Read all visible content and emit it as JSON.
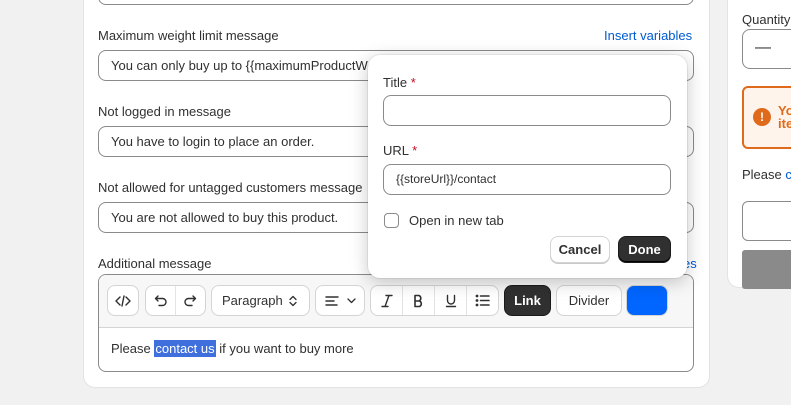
{
  "form": {
    "max_weight": {
      "label": "Maximum weight limit message",
      "insert_variables": "Insert variables",
      "value": "You can only buy up to {{maximumProductWeight}}"
    },
    "not_logged_in": {
      "label": "Not logged in message",
      "value": "You have to login to place an order."
    },
    "not_allowed": {
      "label": "Not allowed for untagged customers message",
      "value": "You are not allowed to buy this product."
    },
    "additional": {
      "label": "Additional message",
      "insert_variables_partial": "es",
      "toolbar": {
        "paragraph": "Paragraph",
        "link": "Link",
        "divider": "Divider",
        "color": "#0066ff"
      },
      "content_before": "Please ",
      "content_selected": "contact us",
      "content_after": " if you want to buy more"
    }
  },
  "link_popover": {
    "title_label": "Title",
    "title_value": "",
    "required_mark": "*",
    "url_label": "URL",
    "url_value": "{{storeUrl}}/contact",
    "open_new_tab": "Open in new tab",
    "cancel": "Cancel",
    "done": "Done"
  },
  "preview": {
    "quantity_label": "Quantity",
    "quantity_minus": "—",
    "alert_text_line1": "Yo",
    "alert_text_line2": "ite",
    "please": "Please ",
    "please_link": "co"
  },
  "colors": {
    "accent_link": "#005bd3",
    "primary_button": "#303030",
    "warning": "#e06a1b",
    "selection": "#3f6fdc"
  }
}
